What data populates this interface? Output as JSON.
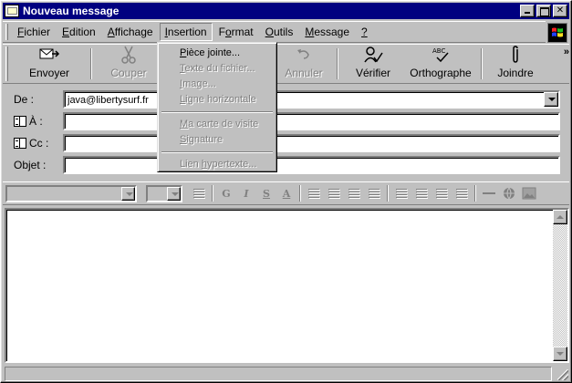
{
  "window": {
    "title": "Nouveau message"
  },
  "menubar": {
    "items": [
      "Fichier",
      "Edition",
      "Affichage",
      "Insertion",
      "Format",
      "Outils",
      "Message",
      "?"
    ],
    "active": "Insertion"
  },
  "toolbar": {
    "buttons": [
      {
        "label": "Envoyer",
        "icon": "send-icon",
        "enabled": true
      },
      {
        "label": "Couper",
        "icon": "scissors-icon",
        "enabled": false
      },
      {
        "label": "Annuler",
        "icon": "undo-icon",
        "enabled": false
      },
      {
        "label": "Vérifier",
        "icon": "check-names-icon",
        "enabled": true
      },
      {
        "label": "Orthographe",
        "icon": "spelling-icon",
        "enabled": true
      },
      {
        "label": "Joindre",
        "icon": "paperclip-icon",
        "enabled": true
      }
    ],
    "overflow": "»"
  },
  "fields": {
    "from_label": "De :",
    "from_value": "java@libertysurf.fr",
    "to_label": "À :",
    "to_value": "",
    "cc_label": "Cc :",
    "cc_value": "",
    "subject_label": "Objet :",
    "subject_value": ""
  },
  "insert_menu": {
    "items": [
      {
        "label": "Pièce jointe...",
        "enabled": true
      },
      {
        "label": "Texte du fichier...",
        "enabled": false
      },
      {
        "label": "Image...",
        "enabled": false
      },
      {
        "label": "Ligne horizontale",
        "enabled": false
      },
      {
        "label": "Ma carte de visite",
        "enabled": false
      },
      {
        "label": "Signature",
        "enabled": false
      },
      {
        "label": "Lien hypertexte...",
        "enabled": false
      }
    ]
  },
  "formatbar": {
    "bold": "G",
    "italic": "I",
    "underline": "S",
    "font_color": "A"
  },
  "colors": {
    "title_bg": "#000080",
    "face": "#c0c0c0",
    "disabled_text": "#808080"
  }
}
